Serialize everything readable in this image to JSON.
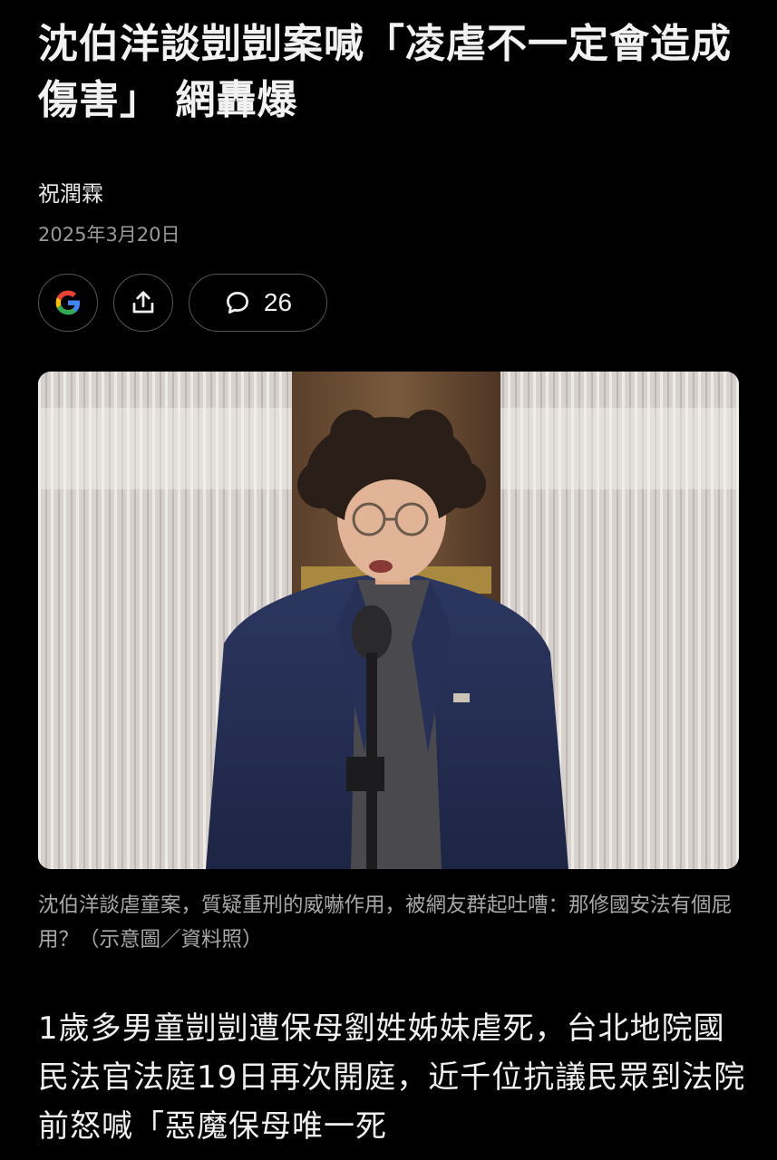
{
  "article": {
    "title": "沈伯洋談剴剴案喊「凌虐不一定會造成傷害」 網轟爆",
    "author": "祝潤霖",
    "date": "2025年3月20日"
  },
  "actions": {
    "google_icon": "google-icon",
    "share_icon": "share-icon",
    "comment_icon": "comment-bubble-icon",
    "comment_count": "26"
  },
  "image": {
    "caption": "沈伯洋談虐童案，質疑重刑的威嚇作用，被網友群起吐嘈：那修國安法有個屁用？（示意圖／資料照）"
  },
  "body": {
    "paragraph_1": "1歲多男童剴剴遭保母劉姓姊妹虐死，台北地院國民法官法庭19日再次開庭，近千位抗議民眾到法院前怒喊「惡魔保母唯一死"
  },
  "colors": {
    "background": "#000000",
    "text_primary": "#f2f2f2",
    "text_secondary": "#9a9a9a",
    "button_border": "#555555"
  }
}
